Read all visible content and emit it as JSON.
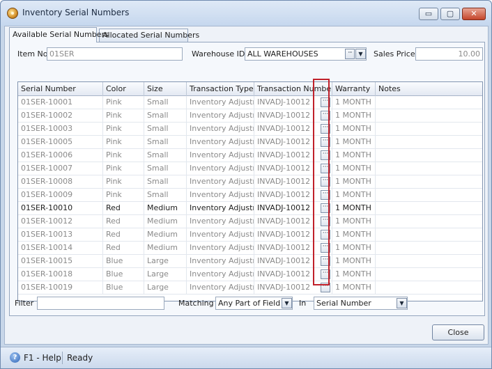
{
  "window": {
    "title": "Inventory Serial Numbers",
    "controls": {
      "minimize": "▭",
      "maximize": "▢",
      "close": "✕"
    }
  },
  "tabs": [
    {
      "label": "Available Serial Numbers",
      "active": true
    },
    {
      "label": "Allocated Serial Numbers",
      "active": false
    }
  ],
  "fields": {
    "item_no": {
      "label": "Item No",
      "value": "01SER"
    },
    "warehouse_id": {
      "label": "Warehouse ID",
      "value": "ALL WAREHOUSES"
    },
    "sales_price": {
      "label": "Sales Price",
      "value": "10.00"
    }
  },
  "grid": {
    "columns": [
      "Serial Number",
      "Color",
      "Size",
      "Transaction Type",
      "Transaction Number",
      "Warranty",
      "Notes"
    ],
    "rows": [
      {
        "serial": "01SER-10001",
        "color": "Pink",
        "size": "Small",
        "type": "Inventory Adjustment",
        "txn": "INVADJ-10012",
        "warranty": "1 MONTH",
        "notes": ""
      },
      {
        "serial": "01SER-10002",
        "color": "Pink",
        "size": "Small",
        "type": "Inventory Adjustment",
        "txn": "INVADJ-10012",
        "warranty": "1 MONTH",
        "notes": ""
      },
      {
        "serial": "01SER-10003",
        "color": "Pink",
        "size": "Small",
        "type": "Inventory Adjustment",
        "txn": "INVADJ-10012",
        "warranty": "1 MONTH",
        "notes": ""
      },
      {
        "serial": "01SER-10005",
        "color": "Pink",
        "size": "Small",
        "type": "Inventory Adjustment",
        "txn": "INVADJ-10012",
        "warranty": "1 MONTH",
        "notes": ""
      },
      {
        "serial": "01SER-10006",
        "color": "Pink",
        "size": "Small",
        "type": "Inventory Adjustment",
        "txn": "INVADJ-10012",
        "warranty": "1 MONTH",
        "notes": ""
      },
      {
        "serial": "01SER-10007",
        "color": "Pink",
        "size": "Small",
        "type": "Inventory Adjustment",
        "txn": "INVADJ-10012",
        "warranty": "1 MONTH",
        "notes": ""
      },
      {
        "serial": "01SER-10008",
        "color": "Pink",
        "size": "Small",
        "type": "Inventory Adjustment",
        "txn": "INVADJ-10012",
        "warranty": "1 MONTH",
        "notes": ""
      },
      {
        "serial": "01SER-10009",
        "color": "Pink",
        "size": "Small",
        "type": "Inventory Adjustment",
        "txn": "INVADJ-10012",
        "warranty": "1 MONTH",
        "notes": ""
      },
      {
        "serial": "01SER-10010",
        "color": "Red",
        "size": "Medium",
        "type": "Inventory Adjustment",
        "txn": "INVADJ-10012",
        "warranty": "1 MONTH",
        "notes": ""
      },
      {
        "serial": "01SER-10012",
        "color": "Red",
        "size": "Medium",
        "type": "Inventory Adjustment",
        "txn": "INVADJ-10012",
        "warranty": "1 MONTH",
        "notes": ""
      },
      {
        "serial": "01SER-10013",
        "color": "Red",
        "size": "Medium",
        "type": "Inventory Adjustment",
        "txn": "INVADJ-10012",
        "warranty": "1 MONTH",
        "notes": ""
      },
      {
        "serial": "01SER-10014",
        "color": "Red",
        "size": "Medium",
        "type": "Inventory Adjustment",
        "txn": "INVADJ-10012",
        "warranty": "1 MONTH",
        "notes": ""
      },
      {
        "serial": "01SER-10015",
        "color": "Blue",
        "size": "Large",
        "type": "Inventory Adjustment",
        "txn": "INVADJ-10012",
        "warranty": "1 MONTH",
        "notes": ""
      },
      {
        "serial": "01SER-10018",
        "color": "Blue",
        "size": "Large",
        "type": "Inventory Adjustment",
        "txn": "INVADJ-10012",
        "warranty": "1 MONTH",
        "notes": ""
      },
      {
        "serial": "01SER-10019",
        "color": "Blue",
        "size": "Large",
        "type": "Inventory Adjustment",
        "txn": "INVADJ-10012",
        "warranty": "1 MONTH",
        "notes": ""
      }
    ],
    "lookup_glyph": "···"
  },
  "filter": {
    "label": "Filter",
    "value": "",
    "matching_label": "Matching",
    "matching_value": "Any Part of Field",
    "in_label": "In",
    "in_value": "Serial Number"
  },
  "buttons": {
    "close": "Close"
  },
  "status": {
    "help": "F1 - Help",
    "text": "Ready"
  },
  "colors": {
    "highlight": "#c0202a",
    "accent": "#2c62b5"
  }
}
